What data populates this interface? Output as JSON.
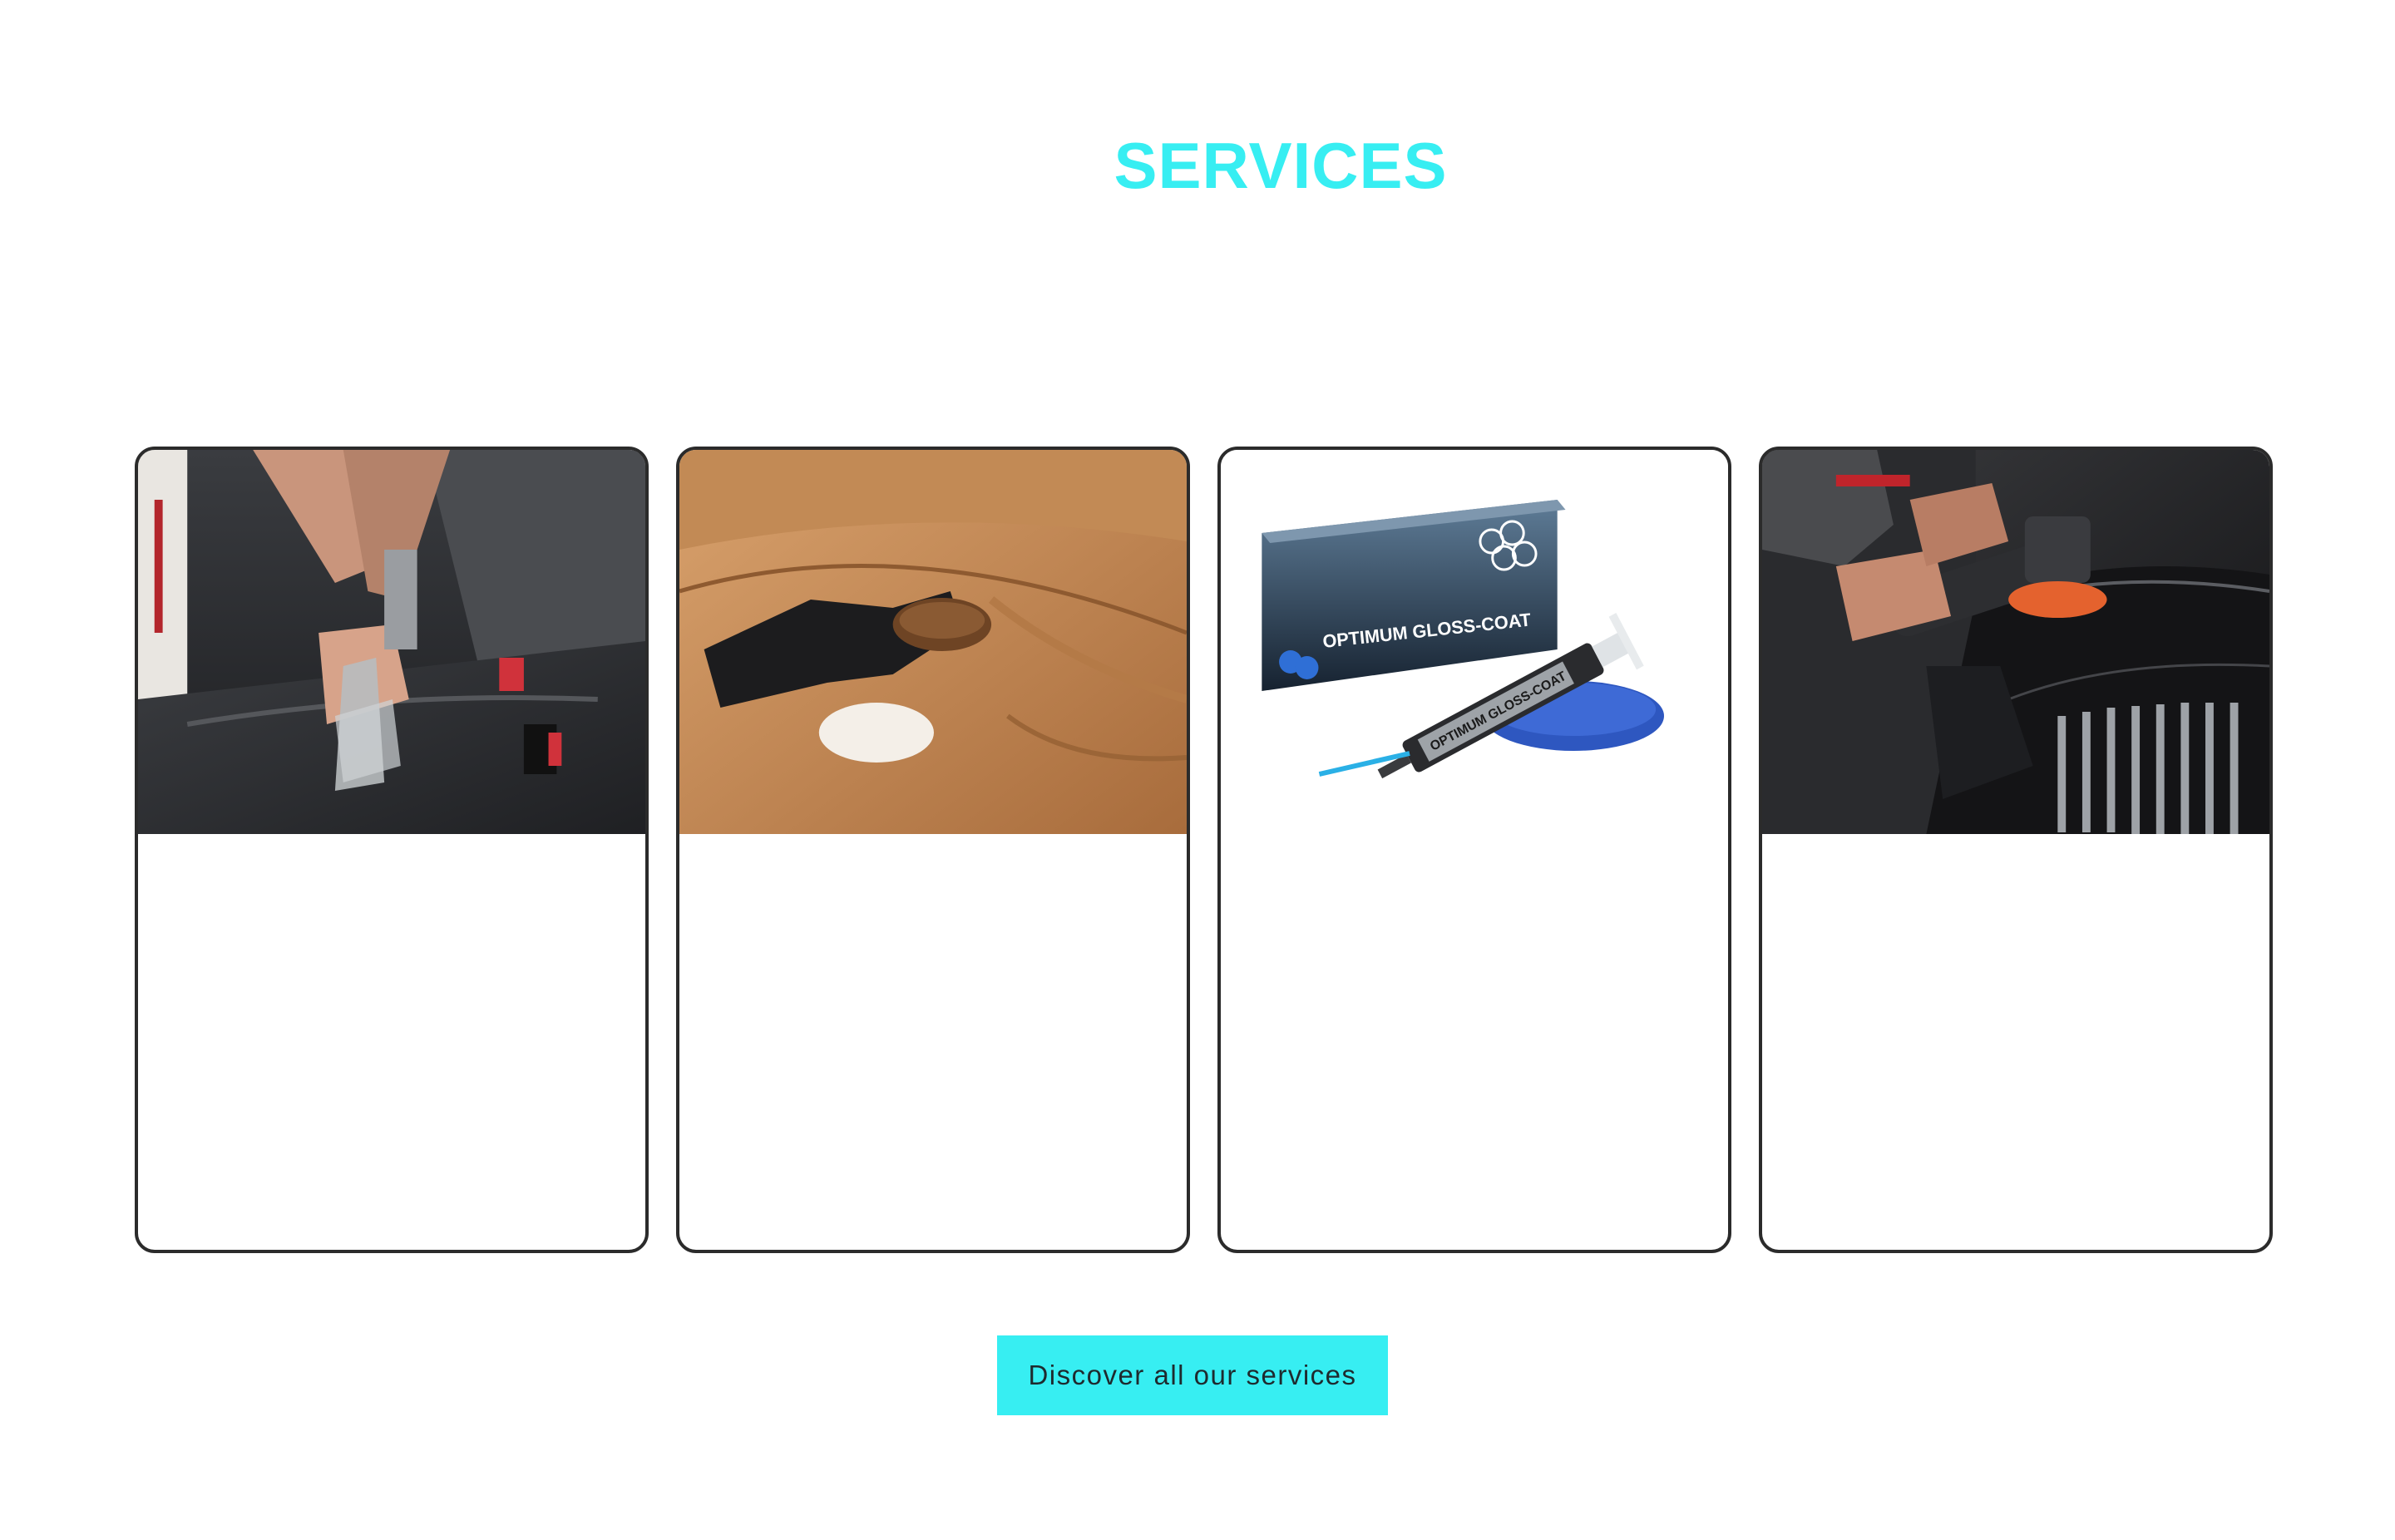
{
  "section": {
    "title": "SERVICES"
  },
  "cards": [
    {
      "image_label": "interior-seat-extraction-cleaning"
    },
    {
      "image_label": "leather-seat-brushing"
    },
    {
      "image_label": "optimum-gloss-coat-product"
    },
    {
      "image_label": "paint-polishing-machine"
    }
  ],
  "product": {
    "box_text": "OPTIMUM GLOSS-COAT",
    "syringe_text": "OPTIMUM GLOSS-COAT"
  },
  "cta": {
    "label": "Discover all our services"
  },
  "colors": {
    "accent": "#37eef2",
    "card_border": "#2b2b2b",
    "text_dark": "#1e2a2e"
  }
}
